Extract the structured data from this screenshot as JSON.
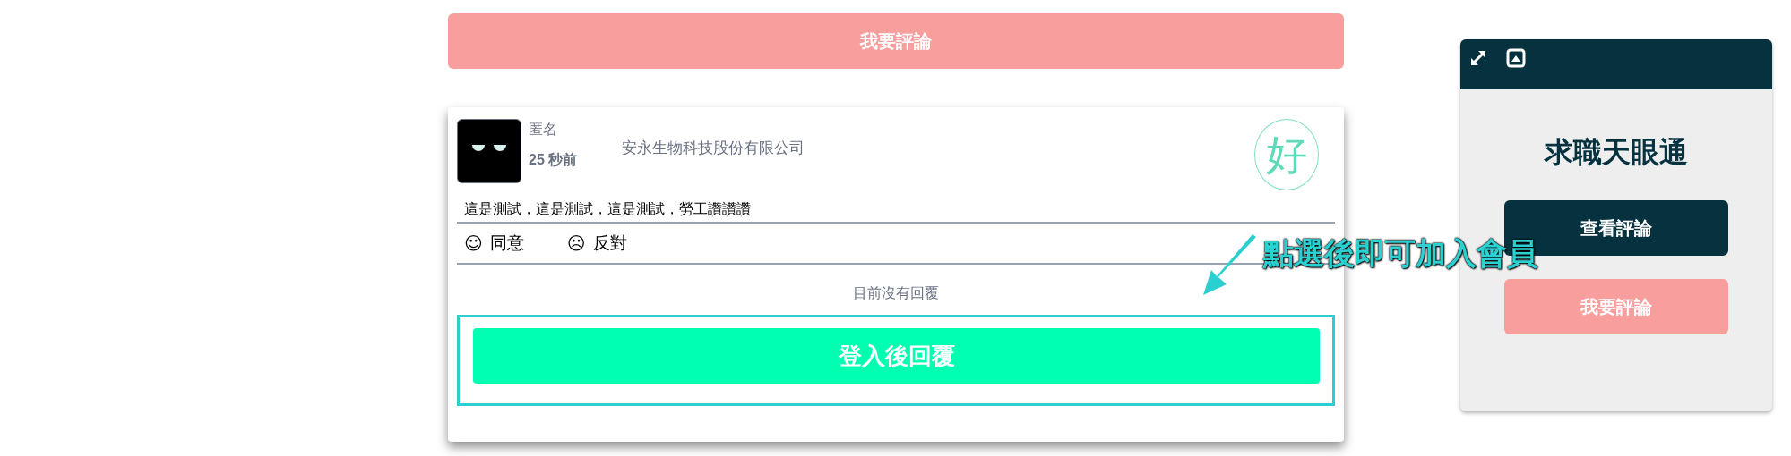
{
  "top_button": "我要評論",
  "review": {
    "author": "匿名",
    "time": "25 秒前",
    "company": "安永生物科技股份有限公司",
    "rating_badge": "好",
    "text": "這是測試，這是測試，這是測試，勞工讚讚讚",
    "reactions": [
      {
        "icon": "☺",
        "label": "同意"
      },
      {
        "icon": "☹",
        "label": "反對"
      }
    ],
    "no_replies": "目前沒有回覆",
    "reply_button": "登入後回覆",
    "highlighted": true
  },
  "annotation": "點選後即可加入會員",
  "widget": {
    "title": "求職天眼通",
    "buttons": [
      {
        "kind": "primary",
        "label": "查看評論"
      },
      {
        "kind": "secondary",
        "label": "我要評論"
      }
    ]
  }
}
